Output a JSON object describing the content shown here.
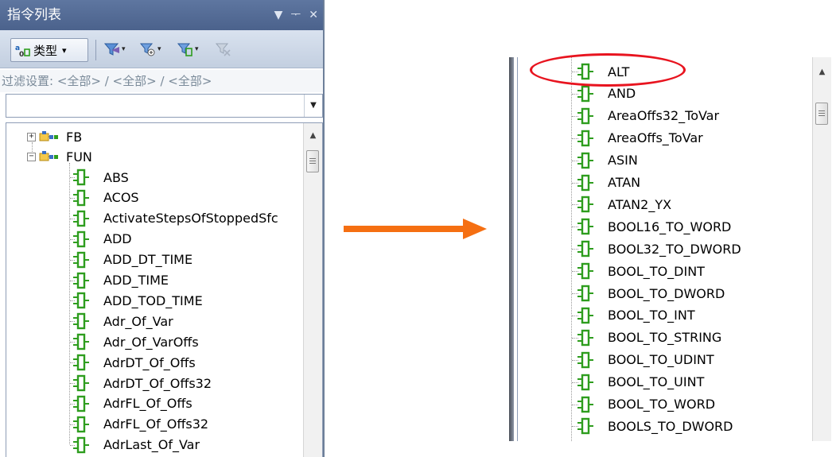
{
  "left_panel": {
    "title": "指令列表",
    "title_buttons": [
      "▼",
      "ᅮ",
      "✕"
    ],
    "toolbar": {
      "type_button_label": "类型",
      "type_button_icon": "type-sort-icon"
    },
    "filter_label": "过滤设置: <全部> / <全部> / <全部>",
    "combo_value": "",
    "tree": {
      "groups": [
        {
          "label": "FB",
          "expanded": false
        },
        {
          "label": "FUN",
          "expanded": true
        }
      ],
      "items": [
        "ABS",
        "ACOS",
        "ActivateStepsOfStoppedSfc",
        "ADD",
        "ADD_DT_TIME",
        "ADD_TIME",
        "ADD_TOD_TIME",
        "Adr_Of_Var",
        "Adr_Of_VarOffs",
        "AdrDT_Of_Offs",
        "AdrDT_Of_Offs32",
        "AdrFL_Of_Offs",
        "AdrFL_Of_Offs32",
        "AdrLast_Of_Var"
      ]
    }
  },
  "right_panel": {
    "items": [
      "ALT",
      "AND",
      "AreaOffs32_ToVar",
      "AreaOffs_ToVar",
      "ASIN",
      "ATAN",
      "ATAN2_YX",
      "BOOL16_TO_WORD",
      "BOOL32_TO_DWORD",
      "BOOL_TO_DINT",
      "BOOL_TO_DWORD",
      "BOOL_TO_INT",
      "BOOL_TO_STRING",
      "BOOL_TO_UDINT",
      "BOOL_TO_UINT",
      "BOOL_TO_WORD",
      "BOOLS_TO_DWORD"
    ],
    "highlighted_item": "ALT"
  },
  "colors": {
    "title_bar": "#4f678f",
    "arrow": "#f56f12",
    "highlight": "#e8141f",
    "function_icon": "#2e9d1e"
  }
}
